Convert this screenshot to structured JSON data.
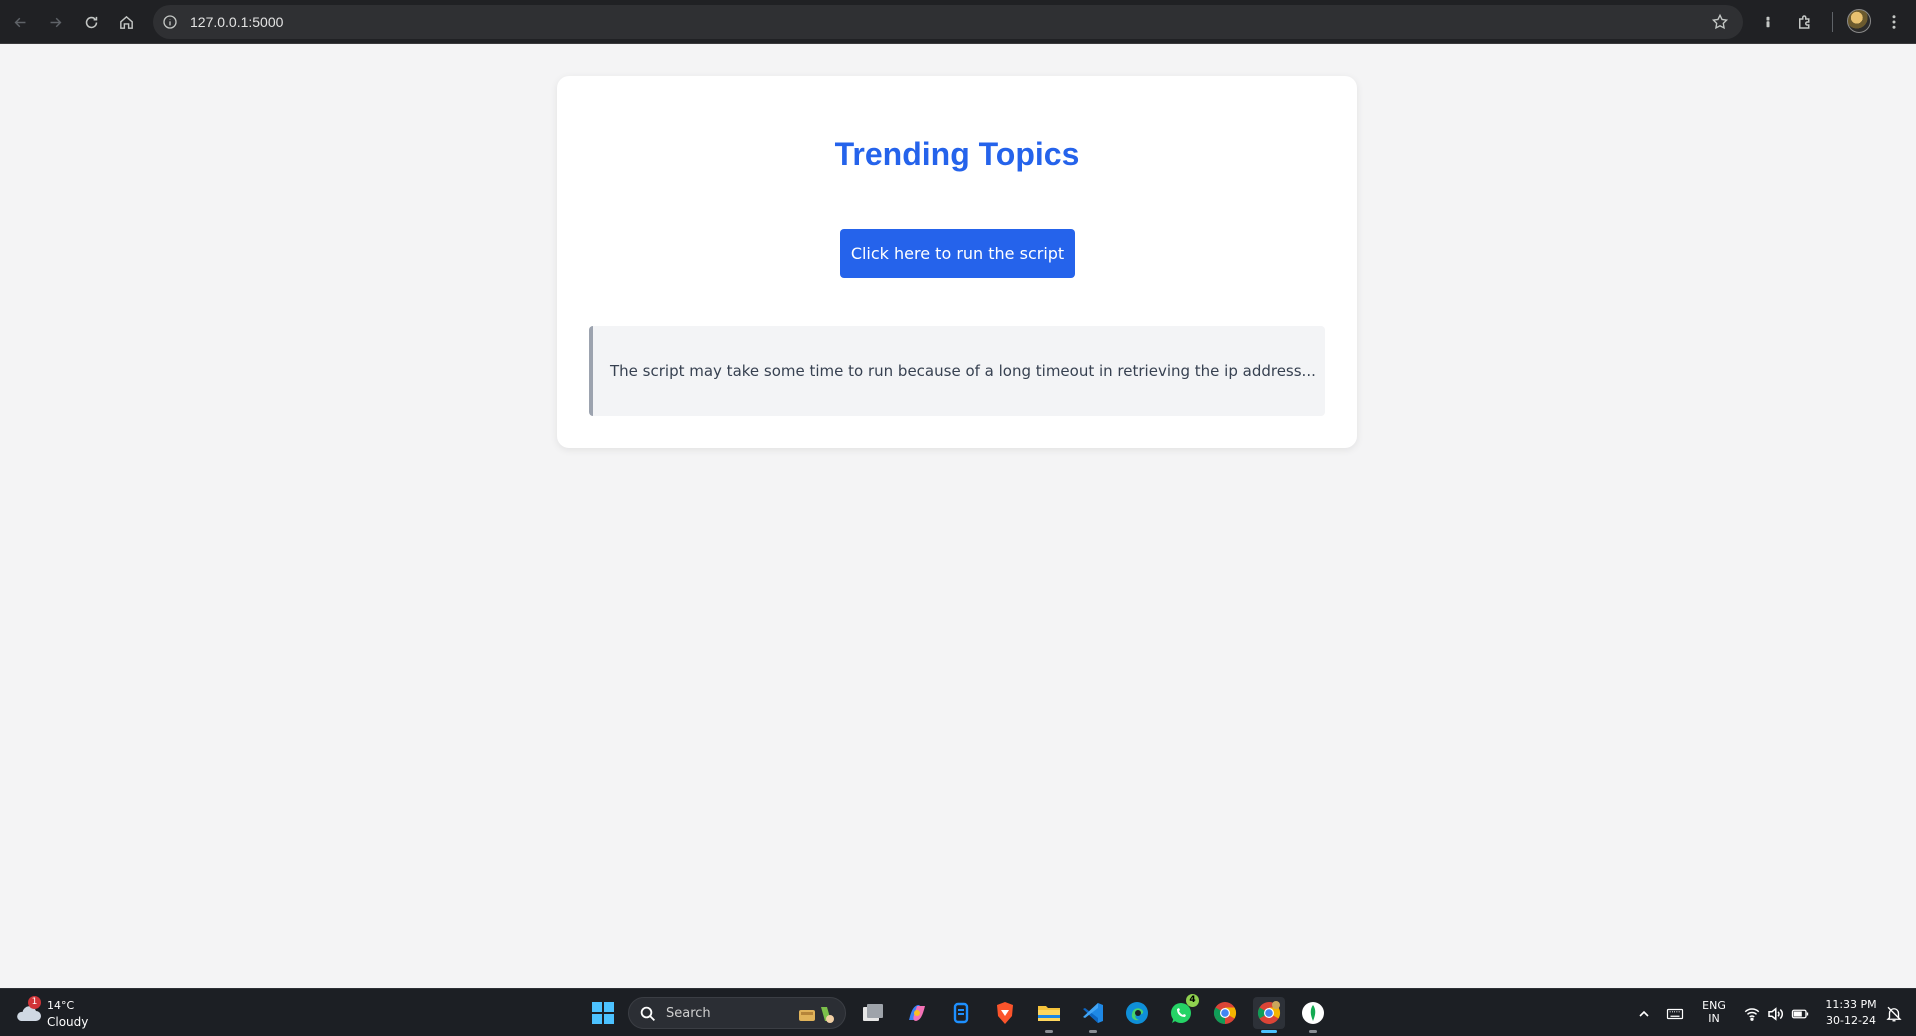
{
  "browser": {
    "url": "127.0.0.1:5000"
  },
  "main": {
    "title": "Trending Topics",
    "run_button_label": "Click here to run the script",
    "notice": "The script may take some time to run because of a long timeout in retrieving the ip address..."
  },
  "taskbar": {
    "weather": {
      "temp": "14°C",
      "condition": "Cloudy",
      "badge": "1"
    },
    "search_label": "Search",
    "whatsapp_badge": "4",
    "language": {
      "line1": "ENG",
      "line2": "IN"
    },
    "clock": {
      "time": "11:33 PM",
      "date": "30-12-24"
    }
  },
  "colors": {
    "accent": "#2563eb",
    "page_bg": "#f4f4f5",
    "card_bg": "#ffffff",
    "notice_bg": "#f3f4f6",
    "notice_border": "#9ca3af",
    "browser_bar": "#202124",
    "taskbar": "#1c1f24"
  }
}
